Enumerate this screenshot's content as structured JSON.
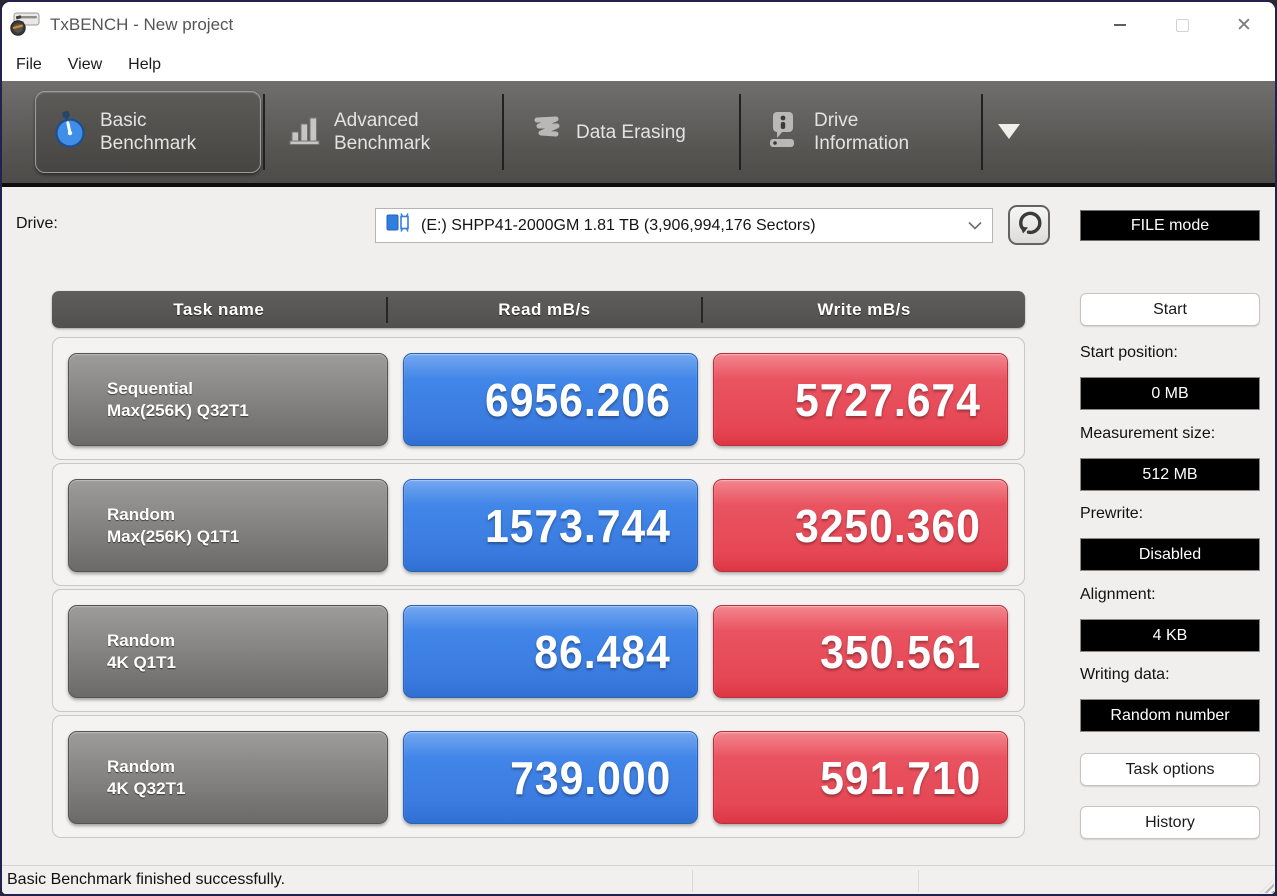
{
  "window": {
    "title": "TxBENCH - New project"
  },
  "menu": {
    "items": [
      {
        "label": "File"
      },
      {
        "label": "View"
      },
      {
        "label": "Help"
      }
    ]
  },
  "tabs": [
    {
      "id": "basic-benchmark",
      "line1": "Basic",
      "line2": "Benchmark",
      "icon": "stopwatch-icon",
      "active": true
    },
    {
      "id": "advanced-benchmark",
      "line1": "Advanced",
      "line2": "Benchmark",
      "icon": "bar-chart-icon",
      "active": false
    },
    {
      "id": "data-erasing",
      "line1": "Data Erasing",
      "line2": "",
      "icon": "scribble-icon",
      "active": false
    },
    {
      "id": "drive-information",
      "line1": "Drive",
      "line2": "Information",
      "icon": "drive-info-icon",
      "active": false
    }
  ],
  "drive_selector": {
    "label": "Drive:",
    "value": "(E:) SHPP41-2000GM  1.81 TB (3,906,994,176 Sectors)",
    "mode_button": "FILE mode"
  },
  "results_table": {
    "headers": [
      "Task name",
      "Read mB/s",
      "Write mB/s"
    ],
    "rows": [
      {
        "task_line1": "Sequential",
        "task_line2": "Max(256K) Q32T1",
        "read": "6956.206",
        "write": "5727.674"
      },
      {
        "task_line1": "Random",
        "task_line2": "Max(256K) Q1T1",
        "read": "1573.744",
        "write": "3250.360"
      },
      {
        "task_line1": "Random",
        "task_line2": "4K Q1T1",
        "read": "86.484",
        "write": "350.561"
      },
      {
        "task_line1": "Random",
        "task_line2": "4K Q32T1",
        "read": "739.000",
        "write": "591.710"
      }
    ]
  },
  "sidebar": {
    "start_button": "Start",
    "fields": [
      {
        "label": "Start position:",
        "value": "0 MB"
      },
      {
        "label": "Measurement size:",
        "value": "512 MB"
      },
      {
        "label": "Prewrite:",
        "value": "Disabled"
      },
      {
        "label": "Alignment:",
        "value": "4 KB"
      },
      {
        "label": "Writing data:",
        "value": "Random number"
      }
    ],
    "task_options_button": "Task options",
    "history_button": "History"
  },
  "status_bar": {
    "message": "Basic Benchmark finished successfully."
  },
  "icons": {
    "close": "✕",
    "dropdown_overflow": "▼"
  },
  "colors": {
    "read_blue": "#3f82e6",
    "write_red": "#e84f5c",
    "task_gray": "#8a8886",
    "tabbar_dark": "#55534f",
    "window_border": "#23224e",
    "value_box_black": "#000000"
  }
}
